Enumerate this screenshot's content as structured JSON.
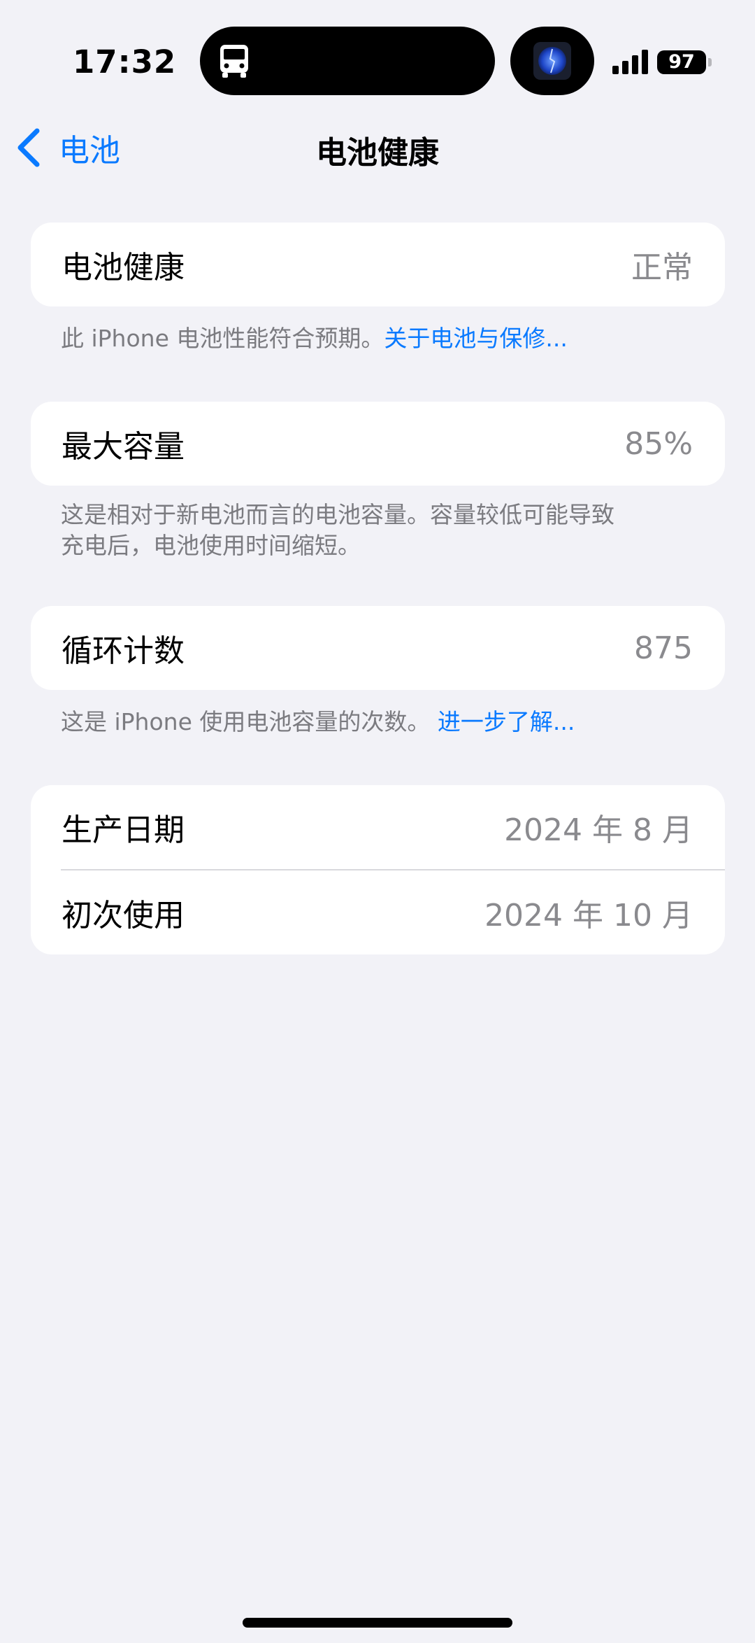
{
  "status_bar": {
    "time": "17:32",
    "battery_level": "97",
    "island_activity_icon": "bus-icon",
    "signal_bars": 4
  },
  "nav": {
    "back_label": "电池",
    "title": "电池健康"
  },
  "battery_health": {
    "label": "电池健康",
    "value": "正常",
    "footnote": "此 iPhone 电池性能符合预期。",
    "footnote_link": "关于电池与保修..."
  },
  "max_capacity": {
    "label": "最大容量",
    "value": "85%",
    "footnote_line1": "这是相对于新电池而言的电池容量。容量较低可能导致",
    "footnote_line2": "充电后，电池使用时间缩短。"
  },
  "cycle_count": {
    "label": "循环计数",
    "value": "875",
    "footnote": "这是 iPhone 使用电池容量的次数。",
    "footnote_link": "进一步了解..."
  },
  "dates": {
    "manufacture_label": "生产日期",
    "manufacture_value": "2024 年 8 月",
    "first_use_label": "初次使用",
    "first_use_value": "2024 年 10 月"
  },
  "colors": {
    "accent": "#0a7aff",
    "background": "#f2f2f7",
    "card": "#ffffff",
    "secondary_text": "#8a8a8e"
  }
}
